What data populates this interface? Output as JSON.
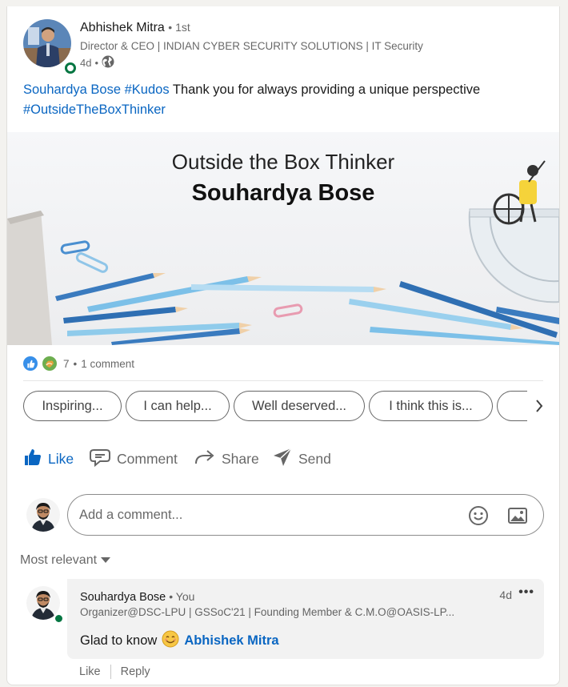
{
  "post": {
    "author": {
      "name": "Abhishek Mitra",
      "degree": "• 1st",
      "headline": "Director & CEO | INDIAN CYBER SECURITY SOLUTIONS | IT Security",
      "time": "4d",
      "visibility_icon": "globe-icon"
    },
    "text": {
      "mention": "Souhardya Bose",
      "hashtag": "#Kudos",
      "body": " Thank you for always providing a unique perspective",
      "hashtag2": "#OutsideTheBoxThinker"
    },
    "banner": {
      "line1": "Outside the Box Thinker",
      "line2": "Souhardya Bose"
    },
    "social": {
      "reactions_count": "7",
      "separator": "•",
      "comments": "1 comment",
      "reaction_icons": [
        "like-reaction-icon",
        "support-reaction-icon"
      ]
    },
    "suggestions": [
      "Inspiring...",
      "I can help...",
      "Well deserved...",
      "I think this is..."
    ],
    "actions": {
      "like": "Like",
      "comment": "Comment",
      "share": "Share",
      "send": "Send"
    },
    "comment_box": {
      "placeholder": "Add a comment..."
    },
    "sort": "Most relevant",
    "comment": {
      "name": "Souhardya Bose",
      "you": "• You",
      "headline": "Organizer@DSC-LPU | GSSoC'21 | Founding Member & C.M.O@OASIS-LP...",
      "time": "4d",
      "more": "•••",
      "text": "Glad to know",
      "mention": "Abhishek Mitra",
      "like": "Like",
      "reply": "Reply"
    }
  },
  "colors": {
    "link": "#0a66c2",
    "presence": "#057642"
  }
}
